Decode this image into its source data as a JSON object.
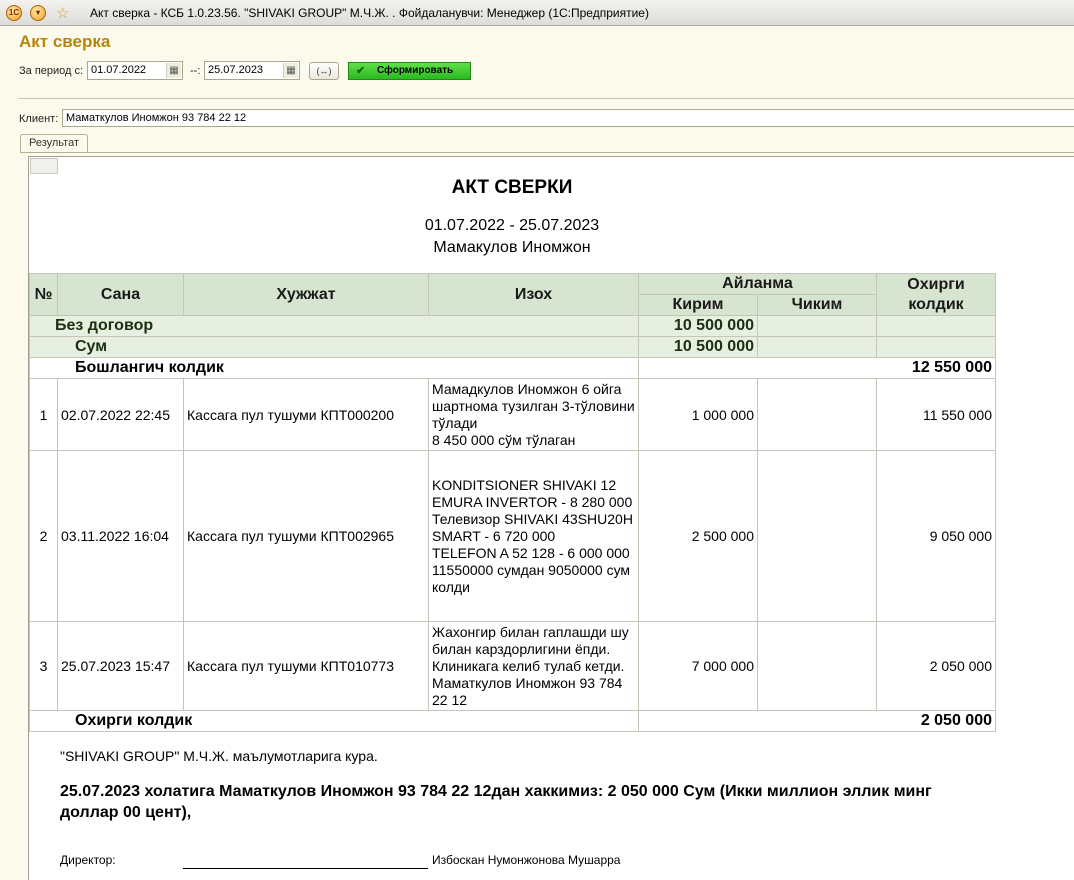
{
  "window": {
    "title": "Акт сверка - КСБ 1.0.23.56. \"SHIVAKI GROUP\" М.Ч.Ж. . Фойдаланувчи: Менеджер  (1С:Предприятие)",
    "logo_text": "1С"
  },
  "form": {
    "title": "Акт сверка",
    "period_label": "За период с:",
    "date_from": "01.07.2022",
    "date_sep": "--:",
    "date_to": "25.07.2023",
    "period_button": "(↔)",
    "generate_button": "Сформировать",
    "client_label": "Клиент:",
    "client_value": "Маматкулов Иномжон 93 784 22 12",
    "tab_label": "Результат"
  },
  "report": {
    "title": "АКТ СВЕРКИ",
    "period": "01.07.2022 - 25.07.2023",
    "client": "Мамакулов Иномжон",
    "headers": {
      "num": "№",
      "date": "Сана",
      "doc": "Хужжат",
      "desc": "Изох",
      "turnover": "Айланма",
      "in": "Кирим",
      "out": "Чиким",
      "end_balance": "Охирги колдик"
    },
    "group1": {
      "label": "Без договор",
      "in": "10 500 000"
    },
    "group2": {
      "label": "Сум",
      "in": "10 500 000"
    },
    "opening": {
      "label": "Бошлангич колдик",
      "value": "12 550 000"
    },
    "rows": [
      {
        "num": "1",
        "date": "02.07.2022 22:45",
        "doc": "Кассага пул тушуми КПТ000200",
        "desc": "Мамадкулов Иномжон 6 ойга шартнома тузилган 3-тўловини тўлади\n8 450 000 сўм тўлаган",
        "in": "1 000 000",
        "out": "",
        "balance": "11 550 000"
      },
      {
        "num": "2",
        "date": "03.11.2022 16:04",
        "doc": "Кассага пул тушуми КПТ002965",
        "desc": "KONDITSIONER SHIVAKI 12 EMURA INVERTOR  - 8 280 000\nТелевизор SHIVAKI 43SHU20H SMART    - 6 720 000\nTELEFON A 52 128    - 6 000 000\n11550000 сумдан 9050000 сум колди",
        "in": "2 500 000",
        "out": "",
        "balance": "9 050 000"
      },
      {
        "num": "3",
        "date": "25.07.2023 15:47",
        "doc": "Кассага пул тушуми КПТ010773",
        "desc": "Жахонгир билан гаплашди шу билан карздорлигини ёпди. Клиникага келиб тулаб кетди. Маматкулов Иномжон 93 784 22 12",
        "in": "7 000 000",
        "out": "",
        "balance": "2 050 000"
      }
    ],
    "closing": {
      "label": "Охирги колдик",
      "value": "2 050 000"
    },
    "note": "\"SHIVAKI GROUP\" М.Ч.Ж. маълумотларига кура.",
    "conclusion": "25.07.2023 холатига Маматкулов Иномжон 93 784 22 12дан хаккимиз: 2 050 000 Сум (Икки миллион эллик минг доллар 00 цент),",
    "director_label": "Директор:",
    "director_name": "Избоскан Нумонжонова Мушарра"
  }
}
